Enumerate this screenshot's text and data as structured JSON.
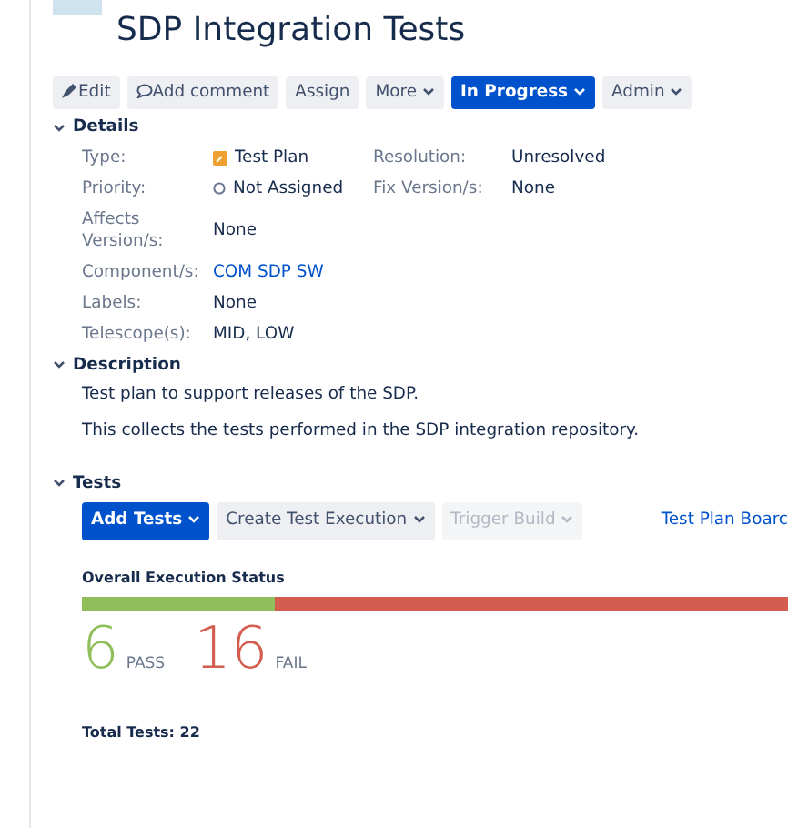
{
  "title": "SDP Integration Tests",
  "toolbar": [
    {
      "label": "Edit",
      "kind": "edit"
    },
    {
      "label": "Add comment",
      "kind": "comment"
    },
    {
      "label": "Assign",
      "kind": "plain"
    },
    {
      "label": "More",
      "kind": "dropdown"
    },
    {
      "label": "In Progress",
      "kind": "primary-dropdown"
    },
    {
      "label": "Admin",
      "kind": "dropdown"
    }
  ],
  "details": {
    "heading": "Details",
    "expanded": true,
    "left": [
      {
        "label": "Type:",
        "value": "Test Plan",
        "kind": "type"
      },
      {
        "label": "Priority:",
        "value": "Not Assigned",
        "kind": "priority"
      },
      {
        "label": "Affects Version/s:",
        "value": "None",
        "kind": "text"
      },
      {
        "label": "Component/s:",
        "value": "COM SDP SW",
        "kind": "link"
      },
      {
        "label": "Labels:",
        "value": "None",
        "kind": "text"
      },
      {
        "label": "Telescope(s):",
        "value": "MID, LOW",
        "kind": "text"
      }
    ],
    "right": [
      {
        "label": "Resolution:",
        "value": "Unresolved"
      },
      {
        "label": "Fix Version/s:",
        "value": "None"
      }
    ]
  },
  "description": {
    "heading": "Description",
    "expanded": true,
    "paragraphs": [
      "Test plan to support releases of the SDP.",
      "This collects the tests performed in the SDP integration repository."
    ]
  },
  "tests": {
    "heading": "Tests",
    "expanded": true,
    "buttons": [
      {
        "label": "Add Tests",
        "kind": "primary",
        "disabled": false
      },
      {
        "label": "Create Test Execution",
        "kind": "default",
        "disabled": false
      },
      {
        "label": "Trigger Build",
        "kind": "default",
        "disabled": true
      }
    ],
    "board_link": "Test Plan Boarc",
    "status_heading": "Overall Execution Status",
    "progress": {
      "level": 0.2727
    },
    "segments": [
      {
        "count": "6",
        "label": "PASS",
        "color": "#8fbe5a"
      },
      {
        "count": "16",
        "label": "FAIL",
        "color": "#d35d4e"
      }
    ],
    "total": "Total Tests: 22"
  }
}
